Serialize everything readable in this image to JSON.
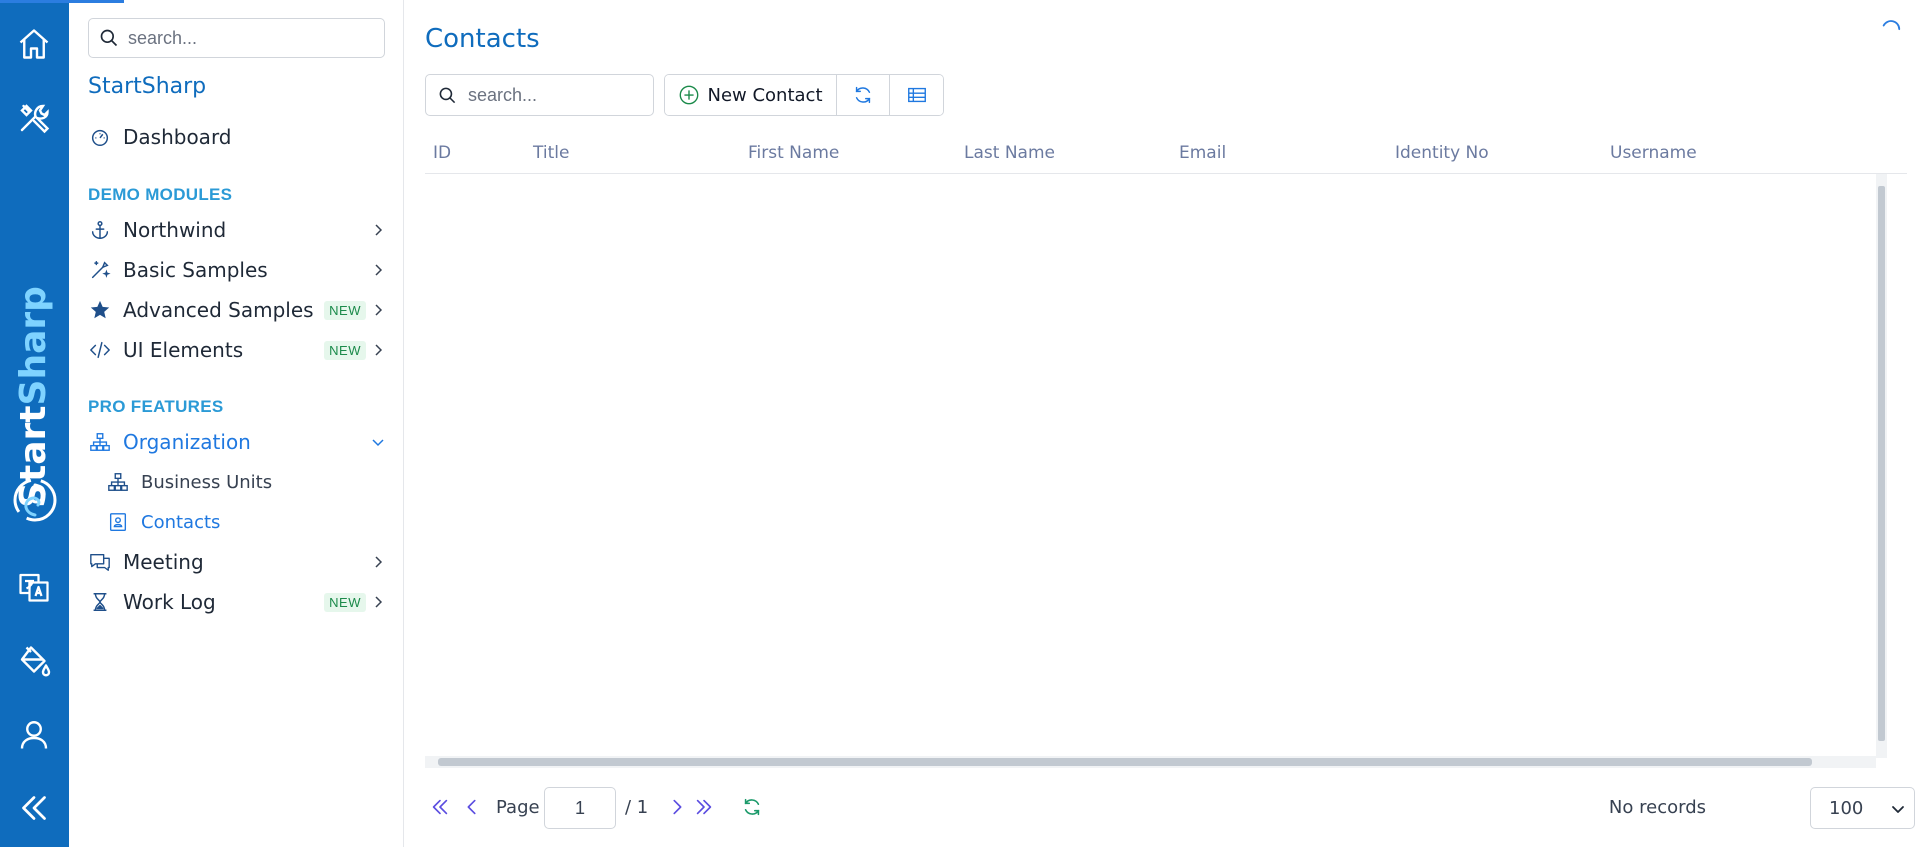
{
  "sidebar": {
    "search_placeholder": "search...",
    "title": "StartSharp",
    "dashboard_label": "Dashboard",
    "sections": {
      "demo_modules": "DEMO MODULES",
      "pro_features": "PRO FEATURES"
    },
    "items": {
      "northwind": "Northwind",
      "basic_samples": "Basic Samples",
      "advanced_samples": "Advanced Samples",
      "ui_elements": "UI Elements",
      "organization": "Organization",
      "business_units": "Business Units",
      "contacts": "Contacts",
      "meeting": "Meeting",
      "work_log": "Work Log"
    },
    "badge_new": "NEW"
  },
  "brand": {
    "part1": "Start",
    "part2": "Sharp"
  },
  "main": {
    "page_title": "Contacts",
    "search_placeholder": "search...",
    "new_contact_label": "New Contact",
    "columns": [
      "ID",
      "Title",
      "First Name",
      "Last Name",
      "Email",
      "Identity No",
      "Username"
    ]
  },
  "pager": {
    "page_label": "Page",
    "current_page": "1",
    "total_pages": "/ 1",
    "status": "No records",
    "page_size": "100"
  },
  "colors": {
    "brand_blue": "#0f6cbd",
    "accent_blue": "#1f78e0",
    "section_teal": "#2b9ad6",
    "badge_green": "#1b8a4a",
    "refresh_green": "#1b9a6a",
    "pager_purple": "#5b4de0"
  }
}
